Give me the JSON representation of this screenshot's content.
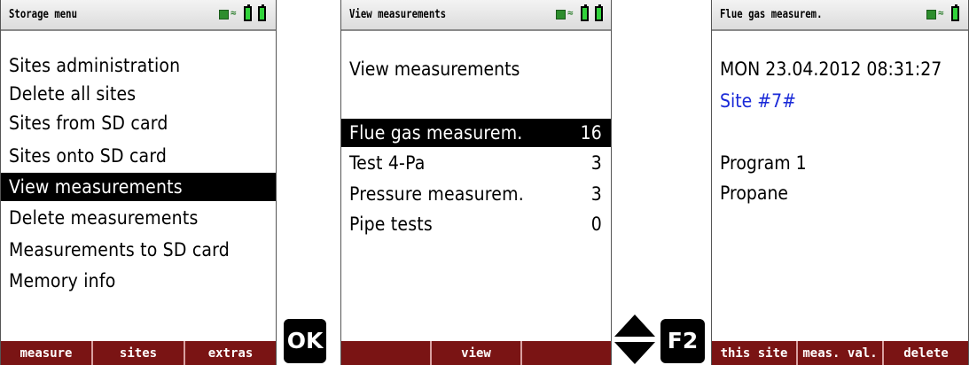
{
  "screen1": {
    "title": "Storage menu",
    "items": [
      {
        "label": "Sites administration"
      },
      {
        "label": "Delete all sites"
      },
      {
        "label": "Sites from SD card"
      },
      {
        "label": "Sites onto SD card"
      },
      {
        "label": "View measurements",
        "selected": true
      },
      {
        "label": "Delete measurements"
      },
      {
        "label": "Measurements to SD card"
      },
      {
        "label": "Memory info"
      }
    ],
    "fkeys": [
      "measure",
      "sites",
      "extras"
    ]
  },
  "ok_key": "OK",
  "screen2": {
    "title": "View measurements",
    "heading": "View measurements",
    "items": [
      {
        "label": "Flue gas measurem.",
        "count": "16",
        "selected": true
      },
      {
        "label": "Test 4-Pa",
        "count": "3"
      },
      {
        "label": "Pressure measurem.",
        "count": "3"
      },
      {
        "label": "Pipe tests",
        "count": "0"
      }
    ],
    "fkeys": [
      "",
      "view",
      ""
    ]
  },
  "f2_key": "F2",
  "screen3": {
    "title": "Flue gas measurem.",
    "datetime": "MON  23.04.2012  08:31:27",
    "site": "Site #7#",
    "program": "Program 1",
    "fuel": "Propane",
    "fkeys": [
      "this site",
      "meas. val.",
      "delete"
    ]
  },
  "colors": {
    "fkey_bar": "#7a1414",
    "battery": "#31d33b",
    "site_text": "#1a2ad8"
  },
  "icons": [
    "sd-card-icon",
    "wireless-icon",
    "battery-icon",
    "up-down-arrow-icon"
  ]
}
